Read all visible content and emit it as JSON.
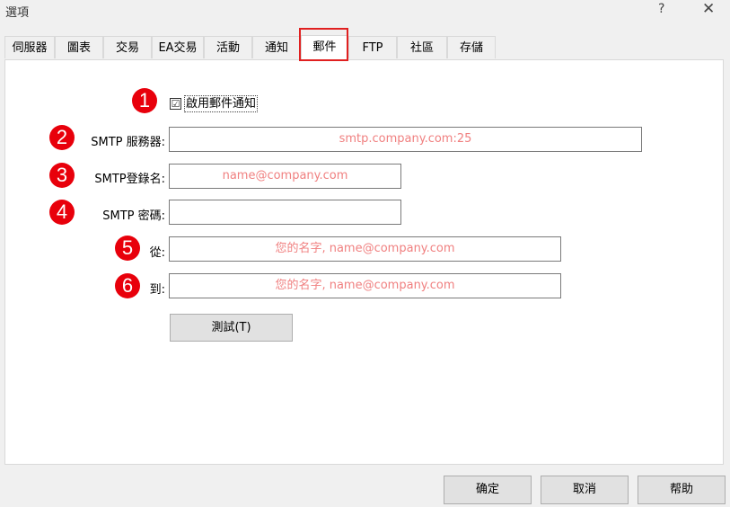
{
  "window": {
    "title": "選項",
    "help": "?",
    "close": "✕"
  },
  "tabs": [
    {
      "label": "伺服器"
    },
    {
      "label": "圖表"
    },
    {
      "label": "交易"
    },
    {
      "label": "EA交易"
    },
    {
      "label": "活動"
    },
    {
      "label": "通知"
    },
    {
      "label": "郵件",
      "active": true
    },
    {
      "label": "FTP"
    },
    {
      "label": "社區"
    },
    {
      "label": "存儲"
    }
  ],
  "form": {
    "enable_mail": {
      "label": "啟用郵件通知",
      "checked": true,
      "check_glyph": "☑"
    },
    "smtp_server": {
      "label": "SMTP 服務器:",
      "value": "smtp.company.com:25"
    },
    "smtp_login": {
      "label": "SMTP登錄名:",
      "value": "name@company.com"
    },
    "smtp_password": {
      "label": "SMTP 密碼:",
      "value": ""
    },
    "from": {
      "label": "從:",
      "value": "您的名字, name@company.com"
    },
    "to": {
      "label": "到:",
      "value": "您的名字, name@company.com"
    },
    "test_button": "測試(T)"
  },
  "badges": [
    "1",
    "2",
    "3",
    "4",
    "5",
    "6"
  ],
  "footer": {
    "ok": "确定",
    "cancel": "取消",
    "help": "帮助"
  },
  "colors": {
    "badge": "#e8000b",
    "highlight": "#e02020",
    "field_text": "#f08080"
  }
}
